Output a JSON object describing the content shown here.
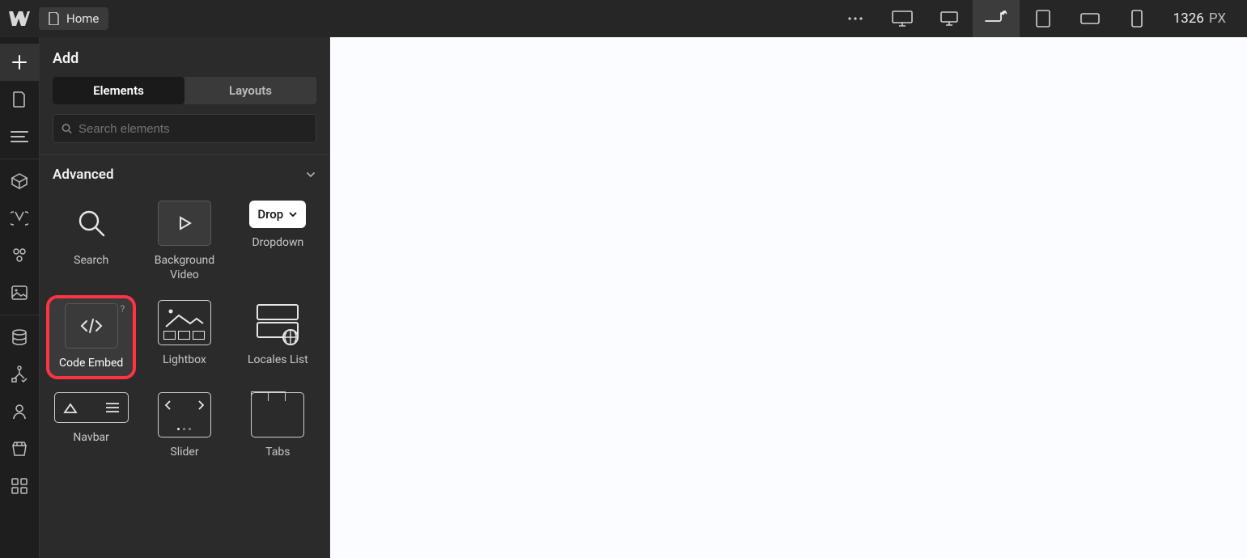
{
  "topbar": {
    "page_name": "Home",
    "viewport_width": "1326",
    "viewport_unit": "PX"
  },
  "panel": {
    "title": "Add",
    "tabs": {
      "elements": "Elements",
      "layouts": "Layouts"
    },
    "search_placeholder": "Search elements",
    "section_title": "Advanced",
    "items": [
      {
        "label": "Search"
      },
      {
        "label": "Background Video"
      },
      {
        "label": "Dropdown",
        "drop_label": "Drop"
      },
      {
        "label": "Code Embed",
        "help": "?"
      },
      {
        "label": "Lightbox"
      },
      {
        "label": "Locales List"
      },
      {
        "label": "Navbar"
      },
      {
        "label": "Slider"
      },
      {
        "label": "Tabs"
      }
    ]
  }
}
